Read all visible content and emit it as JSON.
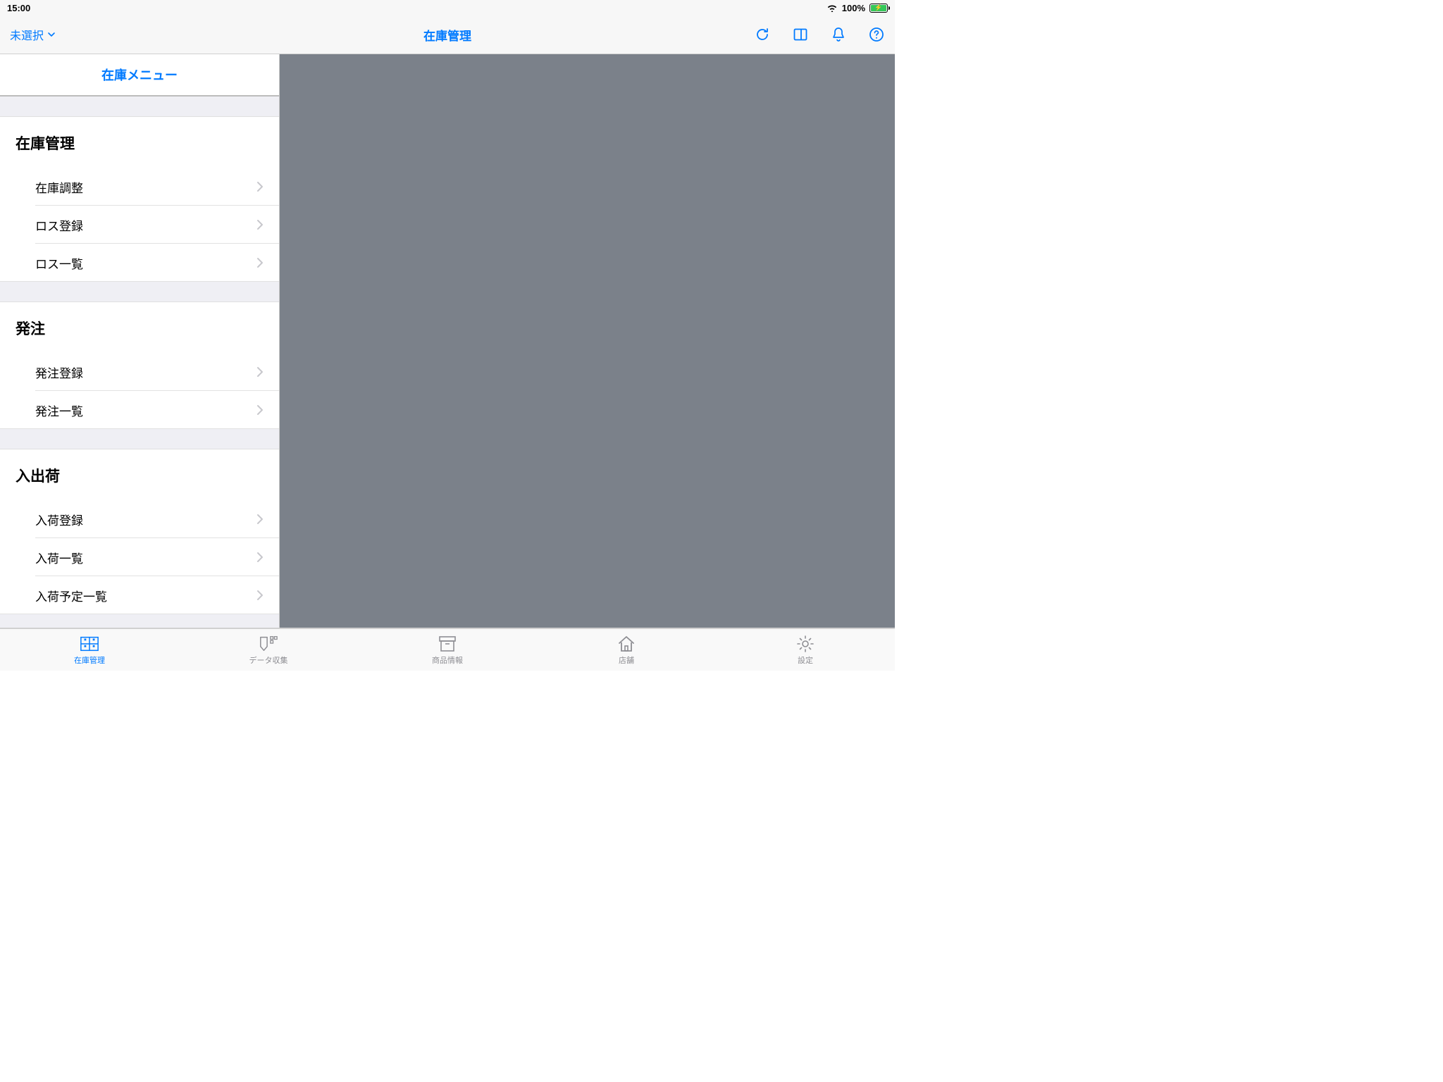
{
  "status": {
    "time": "15:00",
    "battery_text": "100%"
  },
  "nav": {
    "left_label": "未選択",
    "title": "在庫管理"
  },
  "sidebar": {
    "header": "在庫メニュー",
    "sections": [
      {
        "title": "在庫管理",
        "items": [
          "在庫調整",
          "ロス登録",
          "ロス一覧"
        ]
      },
      {
        "title": "発注",
        "items": [
          "発注登録",
          "発注一覧"
        ]
      },
      {
        "title": "入出荷",
        "items": [
          "入荷登録",
          "入荷一覧",
          "入荷予定一覧"
        ]
      }
    ]
  },
  "tabs": [
    {
      "label": "在庫管理",
      "active": true
    },
    {
      "label": "データ収集",
      "active": false
    },
    {
      "label": "商品情報",
      "active": false
    },
    {
      "label": "店舗",
      "active": false
    },
    {
      "label": "設定",
      "active": false
    }
  ]
}
